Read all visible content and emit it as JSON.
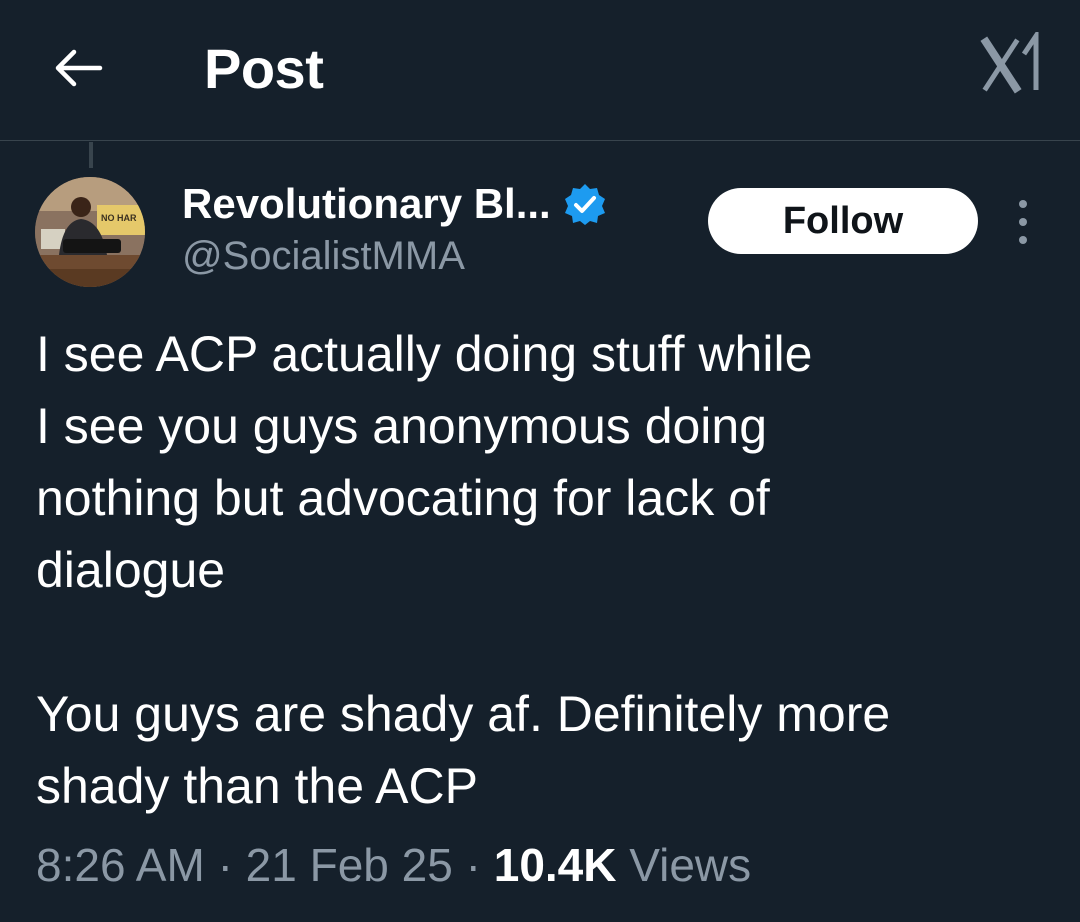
{
  "header": {
    "title": "Post",
    "back_icon": "arrow-left-icon",
    "logo_icon": "x-logo-icon"
  },
  "author": {
    "display_name": "Revolutionary Bl...",
    "handle": "@SocialistMMA",
    "verified": true,
    "verified_color": "#1d9bf0",
    "follow_label": "Follow",
    "more_icon": "more-vertical-icon",
    "avatar_sign_text": "NO HAR"
  },
  "tweet": {
    "paragraph1_lines": [
      "I see ACP actually doing stuff while",
      "I see you guys anonymous doing",
      "nothing but advocating for lack of",
      "dialogue"
    ],
    "paragraph2_lines": [
      "You guys are shady af. Definitely more",
      "shady than the ACP"
    ]
  },
  "meta": {
    "time": "8:26 AM",
    "separator": "·",
    "date": "21 Feb 25",
    "views_count": "10.4K",
    "views_label": "Views"
  },
  "colors": {
    "background": "#15202b",
    "secondary_text": "#8b98a5",
    "divider": "#38444d"
  }
}
